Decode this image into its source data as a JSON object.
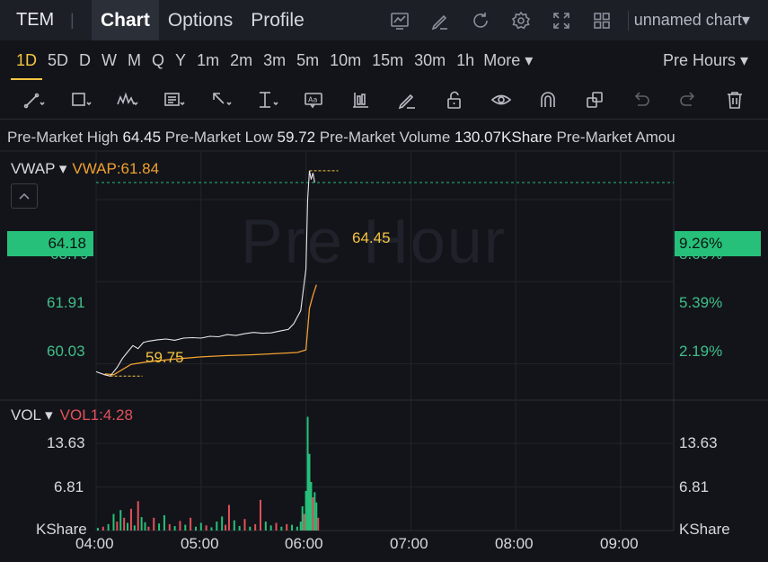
{
  "topbar": {
    "ticker": "TEM",
    "separator": "|",
    "tabs": [
      {
        "label": "Chart",
        "active": true
      },
      {
        "label": "Options",
        "active": false
      },
      {
        "label": "Profile",
        "active": false
      }
    ],
    "icons": [
      "indicator-icon",
      "draw-icon",
      "refresh-icon",
      "settings-icon",
      "fullscreen-icon",
      "layout-icon"
    ],
    "chart_name": "unnamed chart▾"
  },
  "intervals": {
    "items": [
      {
        "label": "1D",
        "active": true
      },
      {
        "label": "5D"
      },
      {
        "label": "D"
      },
      {
        "label": "W"
      },
      {
        "label": "M"
      },
      {
        "label": "Q"
      },
      {
        "label": "Y"
      },
      {
        "label": "1m"
      },
      {
        "label": "2m"
      },
      {
        "label": "3m"
      },
      {
        "label": "5m"
      },
      {
        "label": "10m"
      },
      {
        "label": "15m"
      },
      {
        "label": "30m"
      },
      {
        "label": "1h"
      }
    ],
    "more_label": "More ▾",
    "session_label": "Pre Hours ▾"
  },
  "tools": [
    "trendline-icon",
    "rectangle-icon",
    "pattern-icon",
    "text-note-icon",
    "arrow-icon",
    "measure-icon",
    "label-icon",
    "bars-icon",
    "pencil-icon",
    "lock-icon",
    "eye-icon",
    "magnet-icon",
    "clone-icon",
    "undo-icon",
    "redo-icon",
    "trash-icon"
  ],
  "info": {
    "high_label": "Pre-Market High",
    "high_value": "64.45",
    "low_label": "Pre-Market Low",
    "low_value": "59.72",
    "volume_label": "Pre-Market Volume",
    "volume_value": "130.07KShare",
    "amount_label": "Pre-Market Amou"
  },
  "price_panel": {
    "indicator_name": "VWAP ▾",
    "indicator_value": "VWAP:61.84",
    "watermark": "Pre Hour",
    "current_price": "64.18",
    "current_pct": "9.26%",
    "price_ticks": [
      {
        "label": "63.79",
        "value": 63.79
      },
      {
        "label": "61.91",
        "value": 61.91
      },
      {
        "label": "60.03",
        "value": 60.03
      }
    ],
    "pct_ticks": [
      {
        "label": "8.60%",
        "value": 63.79
      },
      {
        "label": "5.39%",
        "value": 61.91
      },
      {
        "label": "2.19%",
        "value": 60.03
      }
    ],
    "high_marker": "64.45",
    "low_marker": "59.75"
  },
  "volume_panel": {
    "indicator_name": "VOL ▾",
    "indicator_value": "VOL1:4.28",
    "ticks": [
      {
        "label": "13.63",
        "value": 13.63
      },
      {
        "label": "6.81",
        "value": 6.81
      }
    ],
    "unit": "KShare"
  },
  "colors": {
    "up": "#26c07a",
    "down": "#e0525a",
    "price_line": "#e8e8ea",
    "vwap_line": "#f0a030",
    "accent": "#f5c542"
  },
  "chart_data": {
    "type": "line",
    "x_ticks": [
      "04:00",
      "05:00",
      "06:00",
      "07:00",
      "08:00",
      "09:00"
    ],
    "price_ylim": [
      59.2,
      64.9
    ],
    "vol_ylim": [
      0,
      19
    ],
    "series": [
      {
        "name": "VWAP",
        "points": [
          [
            "04:05",
            59.8
          ],
          [
            "04:10",
            59.78
          ],
          [
            "04:20",
            60.02
          ],
          [
            "04:30",
            60.08
          ],
          [
            "04:45",
            60.14
          ],
          [
            "05:00",
            60.19
          ],
          [
            "05:15",
            60.22
          ],
          [
            "05:30",
            60.24
          ],
          [
            "05:45",
            60.27
          ],
          [
            "05:55",
            60.29
          ],
          [
            "06:00",
            60.35
          ],
          [
            "06:02",
            61.3
          ],
          [
            "06:04",
            61.6
          ],
          [
            "06:06",
            61.84
          ]
        ]
      },
      {
        "name": "Price",
        "points": [
          [
            "04:00",
            59.85
          ],
          [
            "04:05",
            59.78
          ],
          [
            "04:08",
            59.75
          ],
          [
            "04:12",
            59.95
          ],
          [
            "04:15",
            60.15
          ],
          [
            "04:18",
            60.3
          ],
          [
            "04:21",
            60.45
          ],
          [
            "04:24",
            60.38
          ],
          [
            "04:27",
            60.52
          ],
          [
            "04:30",
            60.55
          ],
          [
            "04:35",
            60.58
          ],
          [
            "04:40",
            60.6
          ],
          [
            "04:45",
            60.57
          ],
          [
            "04:50",
            60.62
          ],
          [
            "04:55",
            60.63
          ],
          [
            "05:00",
            60.62
          ],
          [
            "05:05",
            60.66
          ],
          [
            "05:10",
            60.65
          ],
          [
            "05:15",
            60.7
          ],
          [
            "05:20",
            60.68
          ],
          [
            "05:25",
            60.72
          ],
          [
            "05:30",
            60.75
          ],
          [
            "05:35",
            60.73
          ],
          [
            "05:40",
            60.74
          ],
          [
            "05:45",
            60.78
          ],
          [
            "05:50",
            60.82
          ],
          [
            "05:53",
            60.95
          ],
          [
            "05:55",
            61.1
          ],
          [
            "05:57",
            61.25
          ],
          [
            "06:00",
            62.2
          ],
          [
            "06:01",
            63.8
          ],
          [
            "06:02",
            64.45
          ],
          [
            "06:03",
            64.25
          ],
          [
            "06:04",
            64.4
          ],
          [
            "06:05",
            64.18
          ]
        ]
      }
    ],
    "volume": [
      {
        "t": "04:01",
        "v": 0.4,
        "dir": "up"
      },
      {
        "t": "04:04",
        "v": 0.6,
        "dir": "down"
      },
      {
        "t": "04:07",
        "v": 1.0,
        "dir": "up"
      },
      {
        "t": "04:10",
        "v": 2.6,
        "dir": "up"
      },
      {
        "t": "04:12",
        "v": 1.4,
        "dir": "down"
      },
      {
        "t": "04:14",
        "v": 3.2,
        "dir": "up"
      },
      {
        "t": "04:16",
        "v": 2.0,
        "dir": "down"
      },
      {
        "t": "04:18",
        "v": 1.2,
        "dir": "up"
      },
      {
        "t": "04:20",
        "v": 3.4,
        "dir": "down"
      },
      {
        "t": "04:22",
        "v": 0.8,
        "dir": "up"
      },
      {
        "t": "04:24",
        "v": 4.6,
        "dir": "down"
      },
      {
        "t": "04:26",
        "v": 2.1,
        "dir": "up"
      },
      {
        "t": "04:28",
        "v": 1.3,
        "dir": "up"
      },
      {
        "t": "04:30",
        "v": 0.6,
        "dir": "down"
      },
      {
        "t": "04:33",
        "v": 2.0,
        "dir": "down"
      },
      {
        "t": "04:36",
        "v": 1.1,
        "dir": "up"
      },
      {
        "t": "04:39",
        "v": 2.4,
        "dir": "up"
      },
      {
        "t": "04:42",
        "v": 1.0,
        "dir": "down"
      },
      {
        "t": "04:45",
        "v": 0.7,
        "dir": "up"
      },
      {
        "t": "04:48",
        "v": 1.5,
        "dir": "down"
      },
      {
        "t": "04:51",
        "v": 0.9,
        "dir": "up"
      },
      {
        "t": "04:54",
        "v": 2.0,
        "dir": "down"
      },
      {
        "t": "04:57",
        "v": 0.6,
        "dir": "up"
      },
      {
        "t": "05:00",
        "v": 1.2,
        "dir": "up"
      },
      {
        "t": "05:03",
        "v": 0.8,
        "dir": "down"
      },
      {
        "t": "05:06",
        "v": 0.5,
        "dir": "up"
      },
      {
        "t": "05:09",
        "v": 1.4,
        "dir": "up"
      },
      {
        "t": "05:12",
        "v": 2.2,
        "dir": "up"
      },
      {
        "t": "05:14",
        "v": 0.9,
        "dir": "down"
      },
      {
        "t": "05:16",
        "v": 4.0,
        "dir": "down"
      },
      {
        "t": "05:19",
        "v": 1.6,
        "dir": "up"
      },
      {
        "t": "05:22",
        "v": 0.7,
        "dir": "up"
      },
      {
        "t": "05:25",
        "v": 1.8,
        "dir": "down"
      },
      {
        "t": "05:28",
        "v": 0.6,
        "dir": "up"
      },
      {
        "t": "05:31",
        "v": 1.0,
        "dir": "down"
      },
      {
        "t": "05:34",
        "v": 4.8,
        "dir": "down"
      },
      {
        "t": "05:37",
        "v": 1.4,
        "dir": "up"
      },
      {
        "t": "05:40",
        "v": 0.8,
        "dir": "up"
      },
      {
        "t": "05:43",
        "v": 1.2,
        "dir": "down"
      },
      {
        "t": "05:46",
        "v": 0.6,
        "dir": "up"
      },
      {
        "t": "05:49",
        "v": 1.0,
        "dir": "down"
      },
      {
        "t": "05:52",
        "v": 0.9,
        "dir": "up"
      },
      {
        "t": "05:55",
        "v": 0.6,
        "dir": "up"
      },
      {
        "t": "05:57",
        "v": 1.4,
        "dir": "up"
      },
      {
        "t": "05:58",
        "v": 3.8,
        "dir": "up"
      },
      {
        "t": "05:59",
        "v": 2.6,
        "dir": "down"
      },
      {
        "t": "06:00",
        "v": 6.2,
        "dir": "up"
      },
      {
        "t": "06:01",
        "v": 17.8,
        "dir": "up"
      },
      {
        "t": "06:02",
        "v": 12.0,
        "dir": "up"
      },
      {
        "t": "06:03",
        "v": 7.6,
        "dir": "up"
      },
      {
        "t": "06:04",
        "v": 5.2,
        "dir": "down"
      },
      {
        "t": "06:05",
        "v": 6.0,
        "dir": "up"
      },
      {
        "t": "06:06",
        "v": 4.4,
        "dir": "up"
      },
      {
        "t": "06:07",
        "v": 2.0,
        "dir": "down"
      }
    ]
  }
}
